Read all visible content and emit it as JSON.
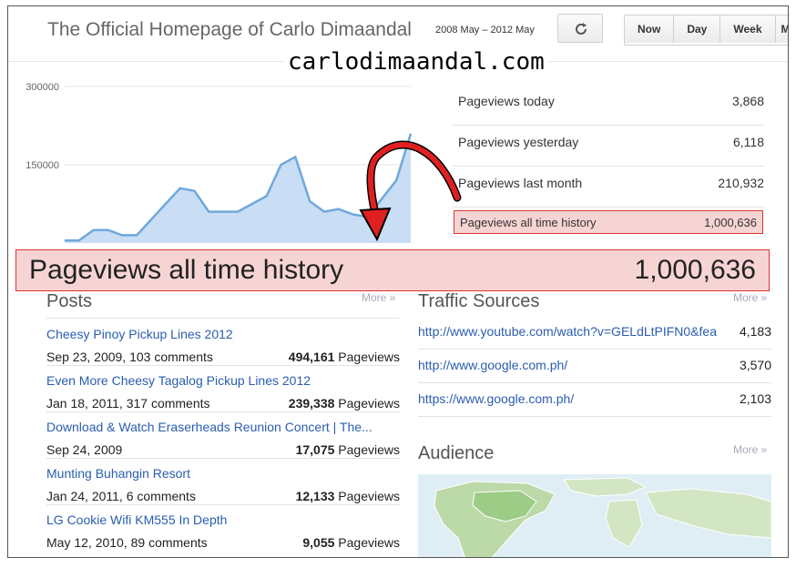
{
  "header": {
    "site_title": "The Official Homepage of Carlo Dimaandal",
    "date_range": "2008 May – 2012 May",
    "refresh_icon": "refresh-icon",
    "range_buttons": [
      "Now",
      "Day",
      "Week",
      "M"
    ]
  },
  "watermark": "carlodimaandal.com",
  "stats": [
    {
      "label": "Pageviews today",
      "value": "3,868"
    },
    {
      "label": "Pageviews yesterday",
      "value": "6,118"
    },
    {
      "label": "Pageviews last month",
      "value": "210,932"
    },
    {
      "label": "Pageviews all time history",
      "value": "1,000,636"
    }
  ],
  "highlight": {
    "label": "Pageviews all time history",
    "value": "1,000,636"
  },
  "chart_data": {
    "type": "area",
    "y_ticks": [
      "300000",
      "150000"
    ],
    "ylim": [
      0,
      300000
    ],
    "values": [
      5000,
      5000,
      25000,
      25000,
      15000,
      15000,
      45000,
      75000,
      105000,
      100000,
      60000,
      60000,
      60000,
      75000,
      90000,
      150000,
      165000,
      80000,
      60000,
      65000,
      55000,
      50000,
      85000,
      120000,
      210000
    ],
    "series_color": "#6fa8dc",
    "fill_color": "#c9ddf5",
    "grid": true
  },
  "posts": {
    "title": "Posts",
    "more": "More »",
    "items": [
      {
        "title": "Cheesy Pinoy Pickup Lines 2012",
        "meta": "Sep 23, 2009, 103 comments",
        "count": "494,161",
        "unit": "Pageviews"
      },
      {
        "title": "Even More Cheesy Tagalog Pickup Lines 2012",
        "meta": "Jan 18, 2011, 317 comments",
        "count": "239,338",
        "unit": "Pageviews"
      },
      {
        "title": "Download & Watch Eraserheads Reunion Concert | The...",
        "meta": "Sep 24, 2009",
        "count": "17,075",
        "unit": "Pageviews"
      },
      {
        "title": "Munting Buhangin Resort",
        "meta": "Jan 24, 2011, 6 comments",
        "count": "12,133",
        "unit": "Pageviews"
      },
      {
        "title": "LG Cookie Wifi KM555 In Depth",
        "meta": "May 12, 2010, 89 comments",
        "count": "9,055",
        "unit": "Pageviews"
      }
    ]
  },
  "traffic": {
    "title": "Traffic Sources",
    "more": "More »",
    "items": [
      {
        "url": "http://www.youtube.com/watch?v=GELdLtPIFN0&fea",
        "count": "4,183"
      },
      {
        "url": "http://www.google.com.ph/",
        "count": "3,570"
      },
      {
        "url": "https://www.google.com.ph/",
        "count": "2,103"
      }
    ]
  },
  "audience": {
    "title": "Audience",
    "more": "More »"
  }
}
